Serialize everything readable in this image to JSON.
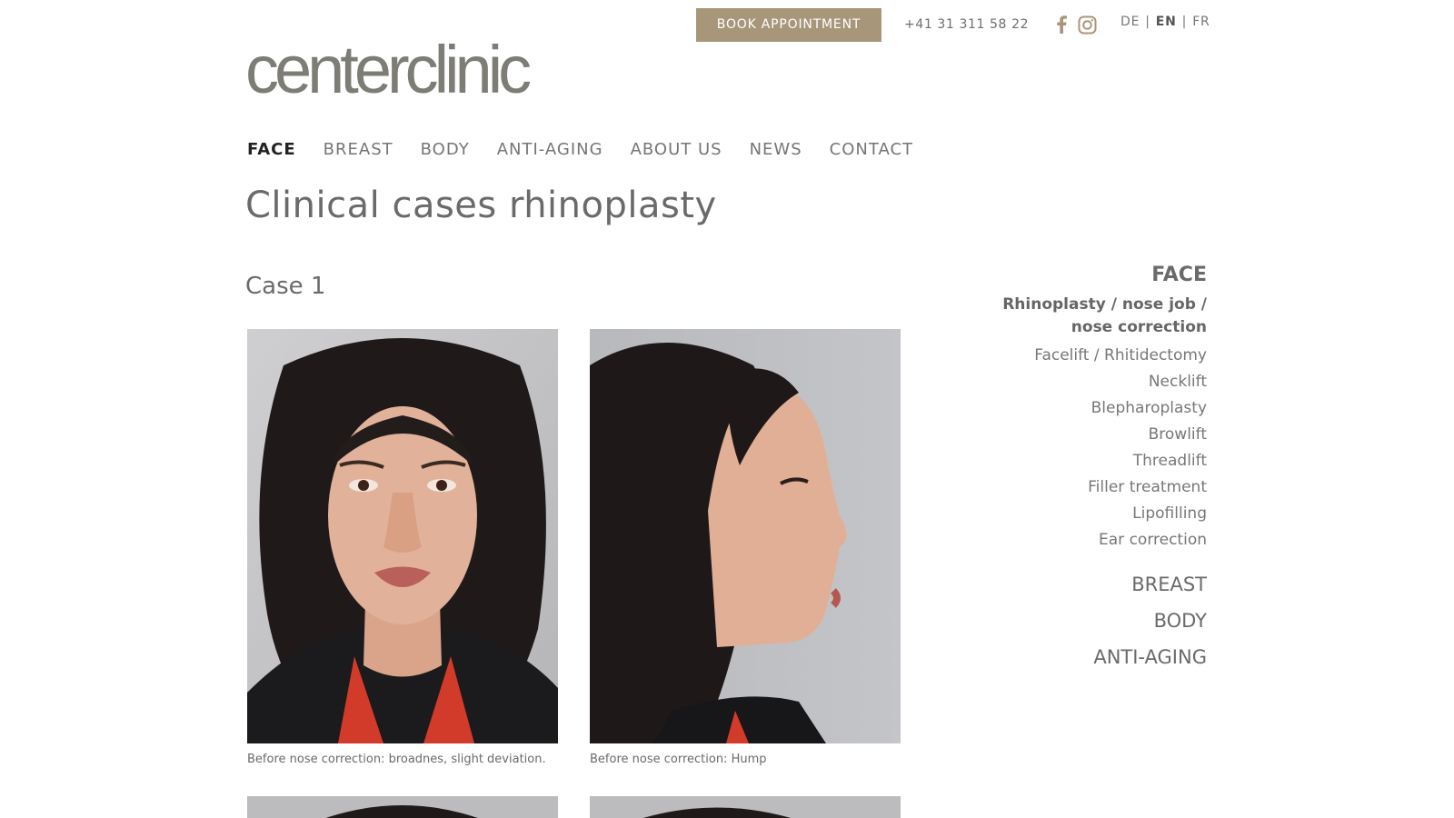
{
  "header": {
    "book_label": "BOOK APPOINTMENT",
    "phone": "+41 31 311 58 22",
    "social": [
      "facebook-icon",
      "instagram-icon"
    ],
    "languages": [
      "DE",
      "EN",
      "FR"
    ],
    "active_language": "EN",
    "logo_text": "centerclinic"
  },
  "nav": {
    "items": [
      "FACE",
      "BREAST",
      "BODY",
      "ANTI-AGING",
      "ABOUT US",
      "NEWS",
      "CONTACT"
    ],
    "active": "FACE"
  },
  "page": {
    "title": "Clinical cases rhinoplasty",
    "case_title": "Case 1",
    "captions": [
      "Before nose correction: broadnes, slight deviation.",
      "Before nose correction: Hump"
    ]
  },
  "sidebar": {
    "heading": "FACE",
    "items": [
      "Rhinoplasty / nose job / nose correction",
      "Facelift / Rhitidectomy",
      "Necklift",
      "Blepharoplasty",
      "Browlift",
      "Threadlift",
      "Filler treatment",
      "Lipofilling",
      "Ear correction"
    ],
    "categories": [
      "BREAST",
      "BODY",
      "ANTI-AGING"
    ]
  },
  "colors": {
    "accent": "#a8967a",
    "logo": "#7d7d76",
    "text": "#6e6e6e"
  }
}
